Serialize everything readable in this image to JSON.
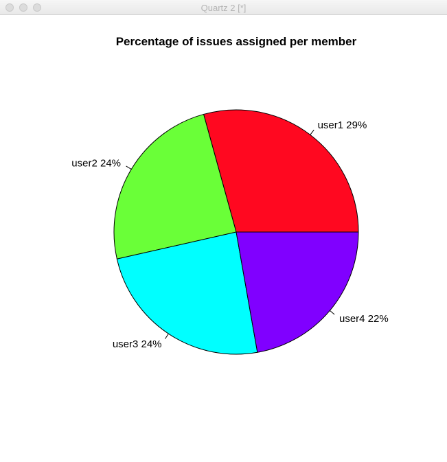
{
  "window": {
    "title": "Quartz 2 [*]"
  },
  "chart_data": {
    "type": "pie",
    "title": "Percentage of issues assigned per member",
    "slices": [
      {
        "label": "user1 29%",
        "value": 29,
        "color": "#ff0820"
      },
      {
        "label": "user2 24%",
        "value": 24,
        "color": "#6aff38"
      },
      {
        "label": "user3 24%",
        "value": 24,
        "color": "#00ffff"
      },
      {
        "label": "user4 22%",
        "value": 22,
        "color": "#8000ff"
      }
    ]
  }
}
